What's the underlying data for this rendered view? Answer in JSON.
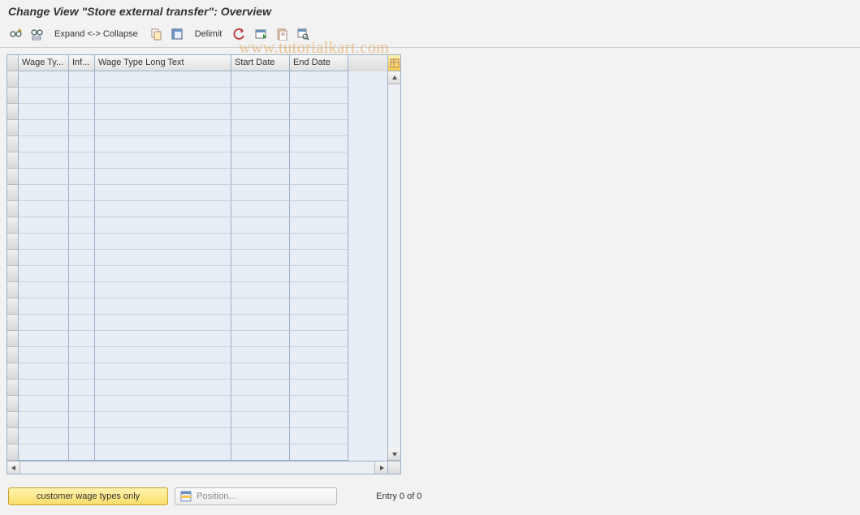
{
  "title": "Change View \"Store external transfer\": Overview",
  "toolbar": {
    "expand_collapse": "Expand <-> Collapse",
    "delimit": "Delimit"
  },
  "table": {
    "columns": {
      "wage_type": "Wage Ty...",
      "inf": "Inf...",
      "long_text": "Wage Type Long Text",
      "start_date": "Start Date",
      "end_date": "End Date"
    },
    "row_count": 24
  },
  "footer": {
    "customer_btn": "customer wage types only",
    "position_btn": "Position...",
    "entry_text": "Entry 0 of 0"
  },
  "watermark": "www.tutorialkart.com"
}
